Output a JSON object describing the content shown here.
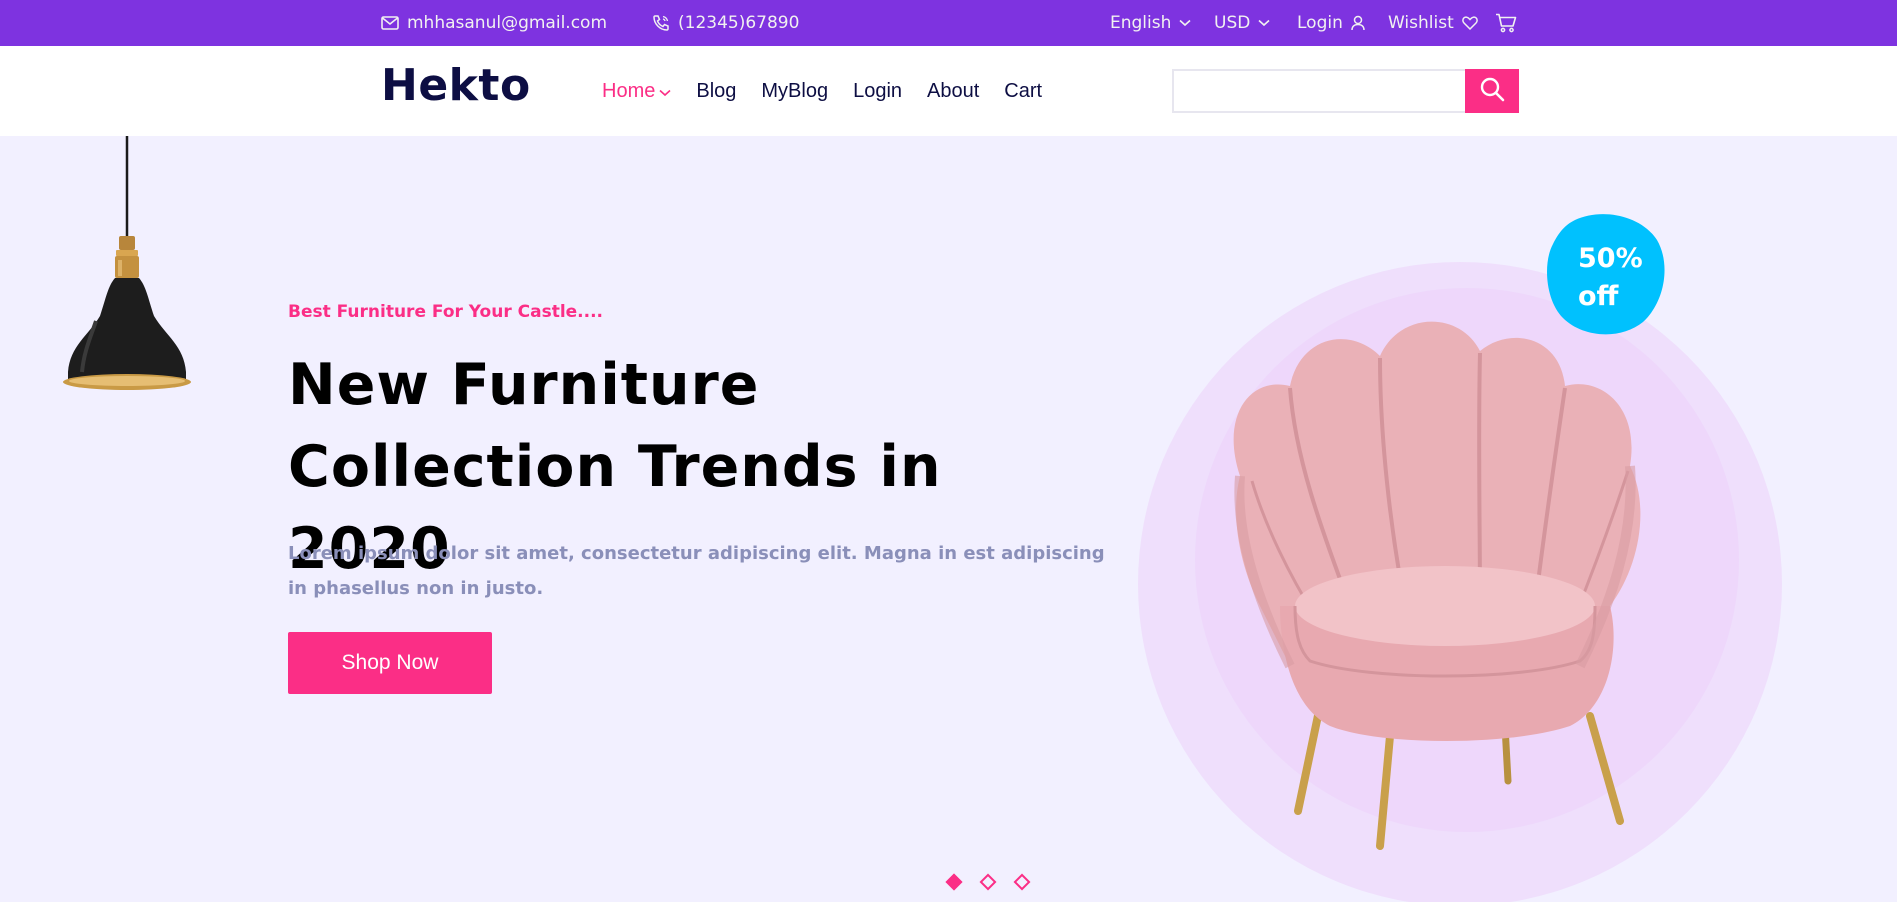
{
  "topbar": {
    "email": "mhhasanul@gmail.com",
    "phone": "(12345)67890",
    "language": "English",
    "currency": "USD",
    "login": "Login",
    "wishlist": "Wishlist",
    "icons": [
      "mail-icon",
      "phone-icon",
      "chevron-down-icon",
      "user-icon",
      "heart-icon",
      "cart-icon"
    ]
  },
  "navbar": {
    "logo": "Hekto",
    "links": [
      "Home",
      "Blog",
      "MyBlog",
      "Login",
      "About",
      "Cart"
    ],
    "active_link": "Home",
    "search": {
      "value": "",
      "placeholder": ""
    }
  },
  "hero": {
    "subtitle": "Best Furniture For Your Castle....",
    "title": "New Furniture Collection Trends in 2020",
    "description": "Lorem ipsum dolor sit amet, consectetur adipiscing elit. Magna in est adipiscing in phasellus non in justo.",
    "button_label": "Shop Now",
    "badge_line1": "50%",
    "badge_line2": "off",
    "slides": 3,
    "active_slide": 1
  },
  "colors": {
    "topbar": "#7E33E0",
    "accent": "#FB2E86",
    "navy": "#0D0E43",
    "hero_bg": "#F2F0FF",
    "badge": "#00C1FE",
    "muted_text": "#8A8FB9"
  }
}
